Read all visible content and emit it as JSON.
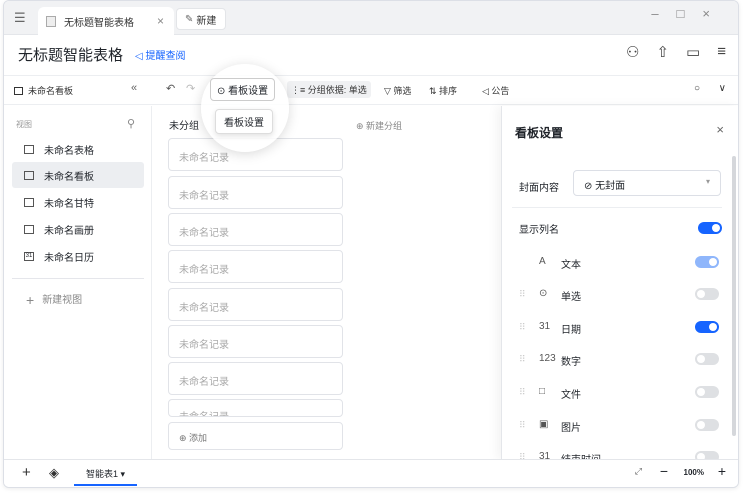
{
  "tabs": {
    "active_title": "无标题智能表格",
    "new_tab": "新建"
  },
  "header": {
    "title": "无标题智能表格",
    "remind": "提醒查阅"
  },
  "toolbar": {
    "view_name": "未命名看板",
    "kanban_settings": "看板设置",
    "group_by": "分组依据: 单选",
    "filter": "筛选",
    "sort": "排序",
    "notice": "公告"
  },
  "tooltip": "看板设置",
  "sidebar": {
    "header": "视图",
    "items": [
      {
        "label": "未命名表格",
        "icon": "table-icon"
      },
      {
        "label": "未命名看板",
        "icon": "kanban-icon"
      },
      {
        "label": "未命名甘特",
        "icon": "gantt-icon"
      },
      {
        "label": "未命名画册",
        "icon": "gallery-icon"
      },
      {
        "label": "未命名日历",
        "icon": "calendar-icon"
      }
    ],
    "new_view": "新建视图"
  },
  "board": {
    "column": "未分组",
    "new_group": "新建分组",
    "cards": [
      "未命名记录",
      "未命名记录",
      "未命名记录",
      "未命名记录",
      "未命名记录",
      "未命名记录",
      "未命名记录",
      "未命名记录"
    ],
    "add": "添加"
  },
  "panel": {
    "title": "看板设置",
    "cover_label": "封面内容",
    "cover_value": "无封面",
    "show_columns": "显示列名",
    "fields": [
      {
        "label": "文本",
        "icon_text": "A",
        "on": true,
        "light": true
      },
      {
        "label": "单选",
        "icon_text": "⊙",
        "on": false
      },
      {
        "label": "日期",
        "icon_text": "31",
        "on": true
      },
      {
        "label": "数字",
        "icon_text": "123",
        "on": false
      },
      {
        "label": "文件",
        "icon_text": "□",
        "on": false
      },
      {
        "label": "图片",
        "icon_text": "▣",
        "on": false
      },
      {
        "label": "结束时间",
        "icon_text": "31",
        "on": false
      }
    ]
  },
  "bottom": {
    "sheet": "智能表1",
    "zoom": "100%"
  },
  "colors": {
    "accent": "#1664ff"
  }
}
